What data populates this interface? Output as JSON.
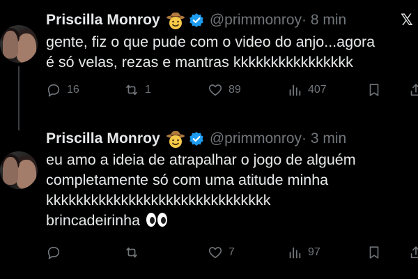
{
  "tweets": [
    {
      "author_name": "Priscilla Monroy",
      "handle": "@primmonroy",
      "time": " · 8 min",
      "text_lines": [
        "gente, fiz o que pude com o video do anjo...agora",
        "é só velas, rezas e mantras kkkkkkkkkkkkkkkk"
      ],
      "reply_count": "16",
      "retweet_count": "1",
      "like_count": "89",
      "view_count": "407"
    },
    {
      "author_name": "Priscilla Monroy",
      "handle": "@primmonroy",
      "time": " · 3 min",
      "text_lines": [
        "eu amo a ideia de atrapalhar o jogo de alguém",
        "completamente só com uma atitude minha",
        "kkkkkkkkkkkkkkkkkkkkkkkkkkkkkk",
        "brincadeirinha"
      ],
      "reply_count": "",
      "retweet_count": "",
      "like_count": "7",
      "view_count": "97"
    }
  ],
  "icons": {
    "name_emoji": "cowboy-face-emoji",
    "verified": "verified-badge-icon",
    "brand": "x-logo-icon",
    "eyes": "eyes-emoji"
  },
  "colors": {
    "background": "#000000",
    "text": "#e7e9ea",
    "muted": "#71767b",
    "verified": "#1d9bf0"
  }
}
